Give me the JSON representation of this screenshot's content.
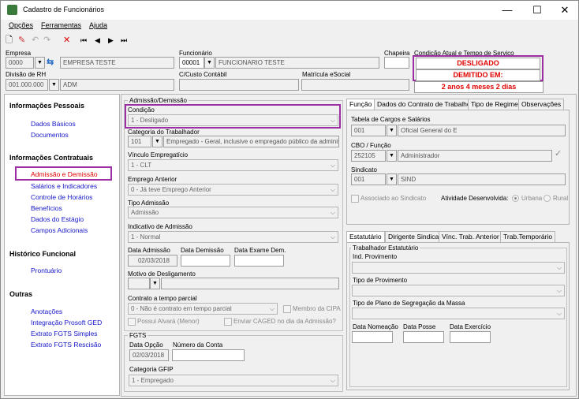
{
  "window": {
    "title": "Cadastro de Funcionários",
    "minimize": "—",
    "maximize": "☐",
    "close": "✕"
  },
  "menu": {
    "opcoes": "Opções",
    "ferramentas": "Ferramentas",
    "ajuda": "Ajuda"
  },
  "toolbar": {
    "new": "🗋",
    "edit": "✎",
    "undo": "↶",
    "redo": "↷",
    "delete": "✕",
    "first": "⏮",
    "prev": "◀",
    "next": "▶",
    "last": "⏭"
  },
  "header": {
    "empresa_label": "Empresa",
    "empresa_code": "0000",
    "empresa_name": "EMPRESA TESTE",
    "funcionario_label": "Funcionário",
    "funcionario_code": "00001",
    "funcionario_name": "FUNCIONARIO TESTE",
    "chapeira_label": "Chapeira",
    "condicao_label": "Condição Atual e Tempo de Serviço",
    "status": "DESLIGADO",
    "demitido": "DEMITIDO EM:",
    "tempo": "2 anos 4 meses 2 dias",
    "divisao_label": "Divisão de RH",
    "divisao_code": "001.000.000",
    "divisao_name": "ADM",
    "custo_label": "C/Custo Contábil",
    "matricula_label": "Matrícula eSocial"
  },
  "sidebar": {
    "sec1": "Informações Pessoais",
    "dados_basicos": "Dados Básicos",
    "documentos": "Documentos",
    "sec2": "Informações Contratuais",
    "admissao": "Admissão e Demissão",
    "salarios": "Salários e Indicadores",
    "horarios": "Controle de Horários",
    "beneficios": "Benefícios",
    "estagio": "Dados do Estágio",
    "campos": "Campos Adicionais",
    "sec3": "Histórico Funcional",
    "prontuario": "Prontuário",
    "sec4": "Outras",
    "anotacoes": "Anotações",
    "prosoft": "Integração Prosoft GED",
    "fgts_simples": "Extrato FGTS Simples",
    "fgts_rescisao": "Extrato FGTS Rescisão"
  },
  "adm": {
    "group": "Admissão/Demissão",
    "condicao_label": "Condição",
    "condicao": "1 - Desligado",
    "categoria_label": "Categoria do Trabalhador",
    "categoria_code": "101",
    "categoria_desc": "Empregado - Geral, inclusive o empregado público da administ",
    "vinculo_label": "Vínculo Empregatício",
    "vinculo": "1 - CLT",
    "emprego_label": "Emprego Anterior",
    "emprego": "0 - Já teve Emprego Anterior",
    "tipo_label": "Tipo Admissão",
    "tipo": "Admissão",
    "indicativo_label": "Indicativo de Admissão",
    "indicativo": "1 - Normal",
    "data_adm_label": "Data Admissão",
    "data_adm": "02/03/2018",
    "data_dem_label": "Data Demissão",
    "data_exame_label": "Data Exame Dem.",
    "motivo_label": "Motivo de Desligamento",
    "contrato_label": "Contrato a tempo parcial",
    "contrato": "0 - Não é contrato em tempo parcial",
    "cipa": "Membro da CIPA",
    "alvara": "Possui Alvará (Menor)",
    "caged": "Enviar CAGED no dia da Admissão?",
    "fgts_group": "FGTS",
    "data_opcao_label": "Data Opção",
    "data_opcao": "02/03/2018",
    "conta_label": "Número da Conta",
    "gfip_label": "Categoria GFIP",
    "gfip": "1 - Empregado"
  },
  "tabs1": {
    "funcao": "Função",
    "dados": "Dados do Contrato de Trabalho",
    "regime": "Tipo de Regime",
    "obs": "Observações"
  },
  "funcao": {
    "tabela_label": "Tabela de Cargos e Salários",
    "tabela_code": "001",
    "tabela_name": "Oficial General do E",
    "cbo_label": "CBO / Função",
    "cbo_code": "252105",
    "cbo_name": "Administrador",
    "sindicato_label": "Sindicato",
    "sindicato_code": "001",
    "sindicato_name": "SIND",
    "associado": "Associado ao Sindicato",
    "atividade_label": "Atividade Desenvolvida:",
    "urbana": "Urbana",
    "rural": "Rural"
  },
  "tabs2": {
    "estatutario": "Estatutário",
    "dirigente": "Dirigente Sindical",
    "vinc": "Vínc. Trab. Anterior",
    "temp": "Trab.Temporário"
  },
  "estat": {
    "group": "Trabalhador Estatutário",
    "ind_label": "Ind. Provimento",
    "tipo_label": "Tipo de Provimento",
    "plano_label": "Tipo de Plano de Segregação da Massa",
    "nomeacao_label": "Data Nomeação",
    "posse_label": "Data Posse",
    "exercicio_label": "Data Exercício"
  }
}
